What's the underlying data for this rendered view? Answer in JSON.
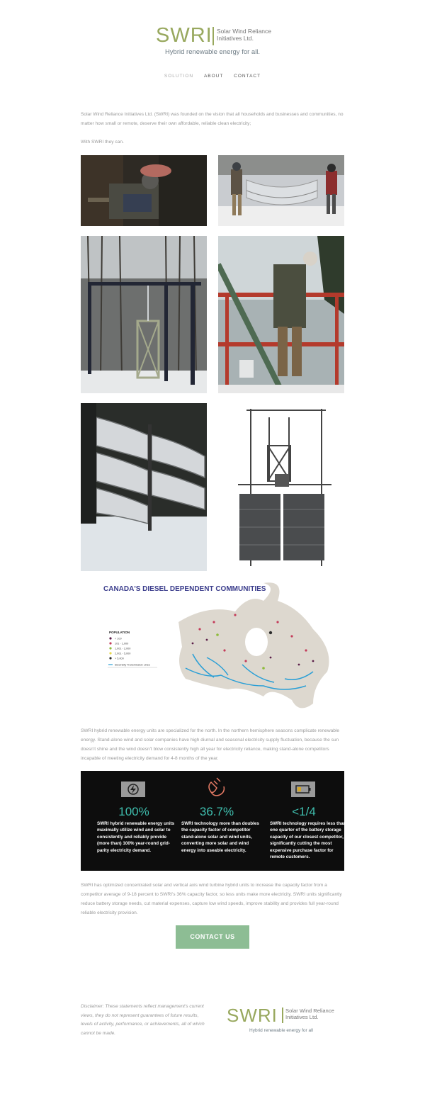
{
  "brand": {
    "mark": "SWRI",
    "name_line1": "Solar Wind Reliance",
    "name_line2": "Initiatives Ltd.",
    "tagline": "Hybrid renewable energy for all.",
    "color": "#98a85e"
  },
  "nav": {
    "items": [
      "SOLUTION",
      "ABOUT",
      "CONTACT"
    ],
    "active": "SOLUTION"
  },
  "intro": {
    "p1": "Solar Wind Reliance Initiatives Ltd. (SWRI) was founded on the vision that all households and businesses and communities, no matter how small or remote, deserve their own affordable, reliable clean electricity;",
    "p2": "With SWRI they can."
  },
  "map": {
    "title": "CANADA'S DIESEL DEPENDENT COMMUNITIES",
    "legend_title": "POPULATION",
    "legend": [
      "< 100",
      "101 - 1,000",
      "1,001 - 2,000",
      "2,001 - 5,000",
      "> 5,000",
      "Electricity Transmission Lines"
    ],
    "legend_colors": [
      "#5a1e48",
      "#c43c5a",
      "#8fbb3c",
      "#e8d84a",
      "#2b2b2b",
      "#2a9fd6"
    ]
  },
  "north": {
    "text": "SWRI hybrid renewable energy units are specialized for the north. In the northern hemisphere seasons complicate renewable energy. Stand-alone wind and solar companies have high diurnal and seasonal electricity supply fluctuation, because the sun doesn't shine and the wind doesn't blow consistently high all year for electricity reliance, making stand-alone competitors incapable of  meeting electricity demand for 4-8 months of the year."
  },
  "stats": [
    {
      "icon": "lightning-icon",
      "value": "100%",
      "desc": "SWRI hybrid renewable energy units maximally utilize wind and solar to consistently and reliably provide (more than) 100% year-round grid-parity electricity demand."
    },
    {
      "icon": "plug-icon",
      "value": "36.7%",
      "desc": "SWRI technology more than doubles the capacity factor of competitor stand-alone solar and wind units, converting more solar and wind energy into useable electricity."
    },
    {
      "icon": "battery-icon",
      "value": "<1/4",
      "desc": "SWRI technology requires less than one quarter of the battery storage capacity of our closest competitor, significantly cutting the most expensive purchase factor for remote customers."
    }
  ],
  "capacity": {
    "text": "SWRI has optimized concentrated solar and vertical axis wind turbine hybrid units to increase the capacity factor from a competitor average of 9-18 percent  to SWRI's 36% capacity factor, so less units make more electricity. SWRI units significantly reduce battery storage needs, cut material expenses, capture low wind speeds, improve stability and provides full year-round reliable electricity provision."
  },
  "cta": {
    "label": "CONTACT US"
  },
  "footer": {
    "disclaimer": "Disclaimer: These statements reflect management's current views, they do not represent guarantees of future results, levels of activity, performance, or achievements, all of which cannot be made.",
    "tagline": "Hybrid renewable energy for all"
  }
}
